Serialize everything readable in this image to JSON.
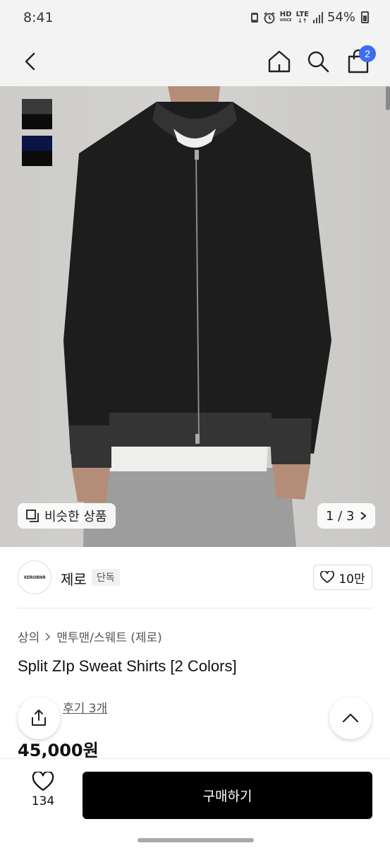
{
  "status_bar": {
    "time": "8:41",
    "hd": "HD",
    "voice": "VOICE",
    "network": "LTE",
    "battery": "54%"
  },
  "nav": {
    "cart_count": "2"
  },
  "hero": {
    "image_alt": "Black zip sweat jacket worn by model",
    "swatch_colors": [
      "#333333",
      "#0b1545"
    ],
    "similar_label": "비슷한 상품",
    "page_indicator": "1 / 3"
  },
  "brand": {
    "logo_text": "XEROBNR",
    "name": "제로",
    "tag": "단독",
    "likes": "10만"
  },
  "product": {
    "breadcrumb": [
      "상의",
      "맨투맨/스웨트 (제로)"
    ],
    "title": "Split ZIp Sweat Shirts [2 Colors]",
    "reviews": "후기 3개",
    "price": "45,000원"
  },
  "bottom_bar": {
    "wish_count": "134",
    "buy_label": "구매하기"
  }
}
